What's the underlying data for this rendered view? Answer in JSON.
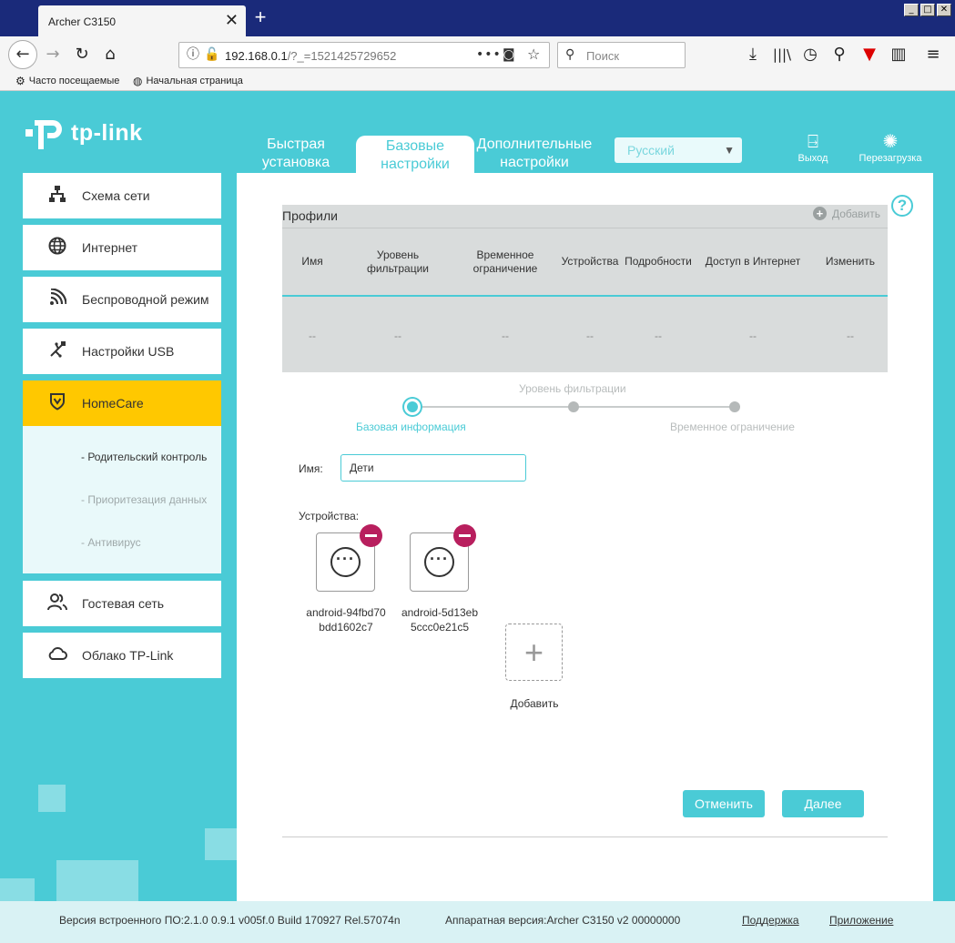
{
  "browser": {
    "tab_title": "Archer C3150",
    "tab_close": "✕",
    "new_tab": "+",
    "window_buttons": [
      "_",
      "□",
      "✕"
    ],
    "url_host": "192.168.0.1",
    "url_path": "/?_=1521425729652",
    "search_placeholder": "Поиск",
    "bookmarks": [
      "Часто посещаемые",
      "Начальная страница"
    ]
  },
  "brand": {
    "logo": "tp-link"
  },
  "topnav": {
    "items": [
      {
        "label": "Быстрая установка"
      },
      {
        "label": "Базовые настройки"
      },
      {
        "label": "Дополнительные настройки"
      }
    ],
    "language": "Русский",
    "logout": "Выход",
    "reboot": "Перезагрузка"
  },
  "sidebar": {
    "items": [
      {
        "label": "Схема сети",
        "icon": "network-map-icon"
      },
      {
        "label": "Интернет",
        "icon": "globe-icon"
      },
      {
        "label": "Беспроводной режим",
        "icon": "wifi-icon"
      },
      {
        "label": "Настройки USB",
        "icon": "usb-icon"
      },
      {
        "label": "HomeCare",
        "icon": "shield-icon"
      },
      {
        "label": "Гостевая сеть",
        "icon": "guests-icon"
      },
      {
        "label": "Облако TP-Link",
        "icon": "cloud-icon"
      }
    ],
    "submenu": [
      {
        "label": "- Родительский контроль"
      },
      {
        "label": "- Приоритезация данных"
      },
      {
        "label": "- Антивирус"
      }
    ]
  },
  "profiles": {
    "title": "Профили",
    "add_label": "Добавить",
    "columns": [
      "Имя",
      "Уровень фильтрации",
      "Временное ограничение",
      "Устройства",
      "Подробности",
      "Доступ в Интернет",
      "Изменить"
    ],
    "row": [
      "--",
      "--",
      "--",
      "--",
      "--",
      "--",
      "--"
    ]
  },
  "stepper": {
    "steps": [
      "Базовая информация",
      "Уровень фильтрации",
      "Временное ограничение"
    ],
    "active_step": 0
  },
  "form": {
    "name_label": "Имя:",
    "name_value": "Дети",
    "devices_label": "Устройства:",
    "devices": [
      {
        "name": "android-94fbd70bdd1602c7"
      },
      {
        "name": "android-5d13eb5ccc0e21c5"
      }
    ],
    "add_device_label": "Добавить",
    "cancel_label": "Отменить",
    "next_label": "Далее"
  },
  "footer": {
    "firmware": "Версия встроенного ПО:2.1.0 0.9.1 v005f.0 Build 170927 Rel.57074n",
    "hardware": "Аппаратная версия:Archer C3150 v2 00000000",
    "support": "Поддержка",
    "app": "Приложение"
  },
  "colors": {
    "accent": "#4acbd6",
    "active_menu": "#ffc800",
    "remove": "#b81f5e",
    "titlebar": "#1a2a7a"
  }
}
